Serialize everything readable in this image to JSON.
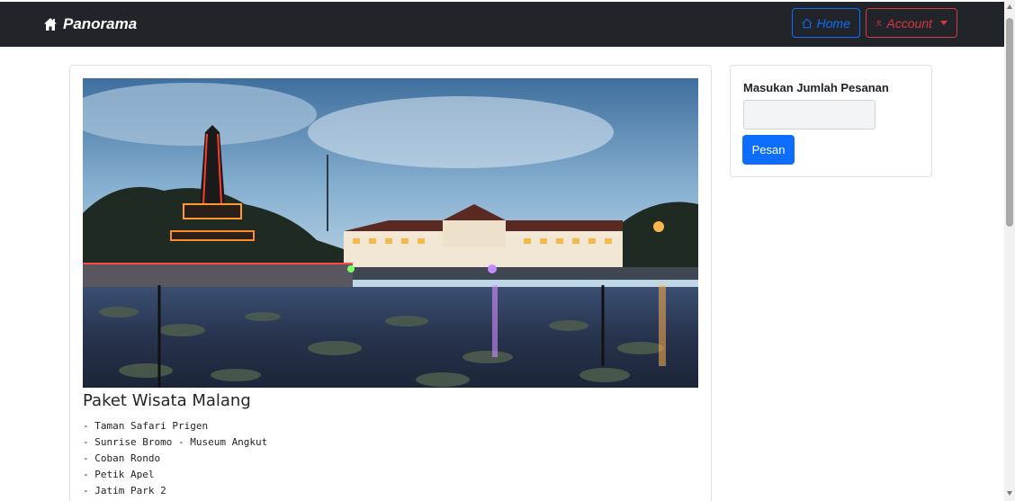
{
  "navbar": {
    "brand": "Panorama",
    "home_label": "Home",
    "account_label": "Account"
  },
  "main": {
    "image_alt": "Alun-alun Tugu Malang",
    "title": "Paket Wisata Malang",
    "items": [
      "- Taman Safari Prigen",
      "- Sunrise Bromo - Museum Angkut",
      "- Coban Rondo",
      "- Petik Apel",
      "- Jatim Park 2"
    ]
  },
  "order": {
    "label": "Masukan Jumlah Pesanan",
    "quantity_value": "",
    "button_label": "Pesan"
  },
  "colors": {
    "navbar_bg": "#212529",
    "primary": "#0d6efd",
    "danger": "#dc3545"
  }
}
